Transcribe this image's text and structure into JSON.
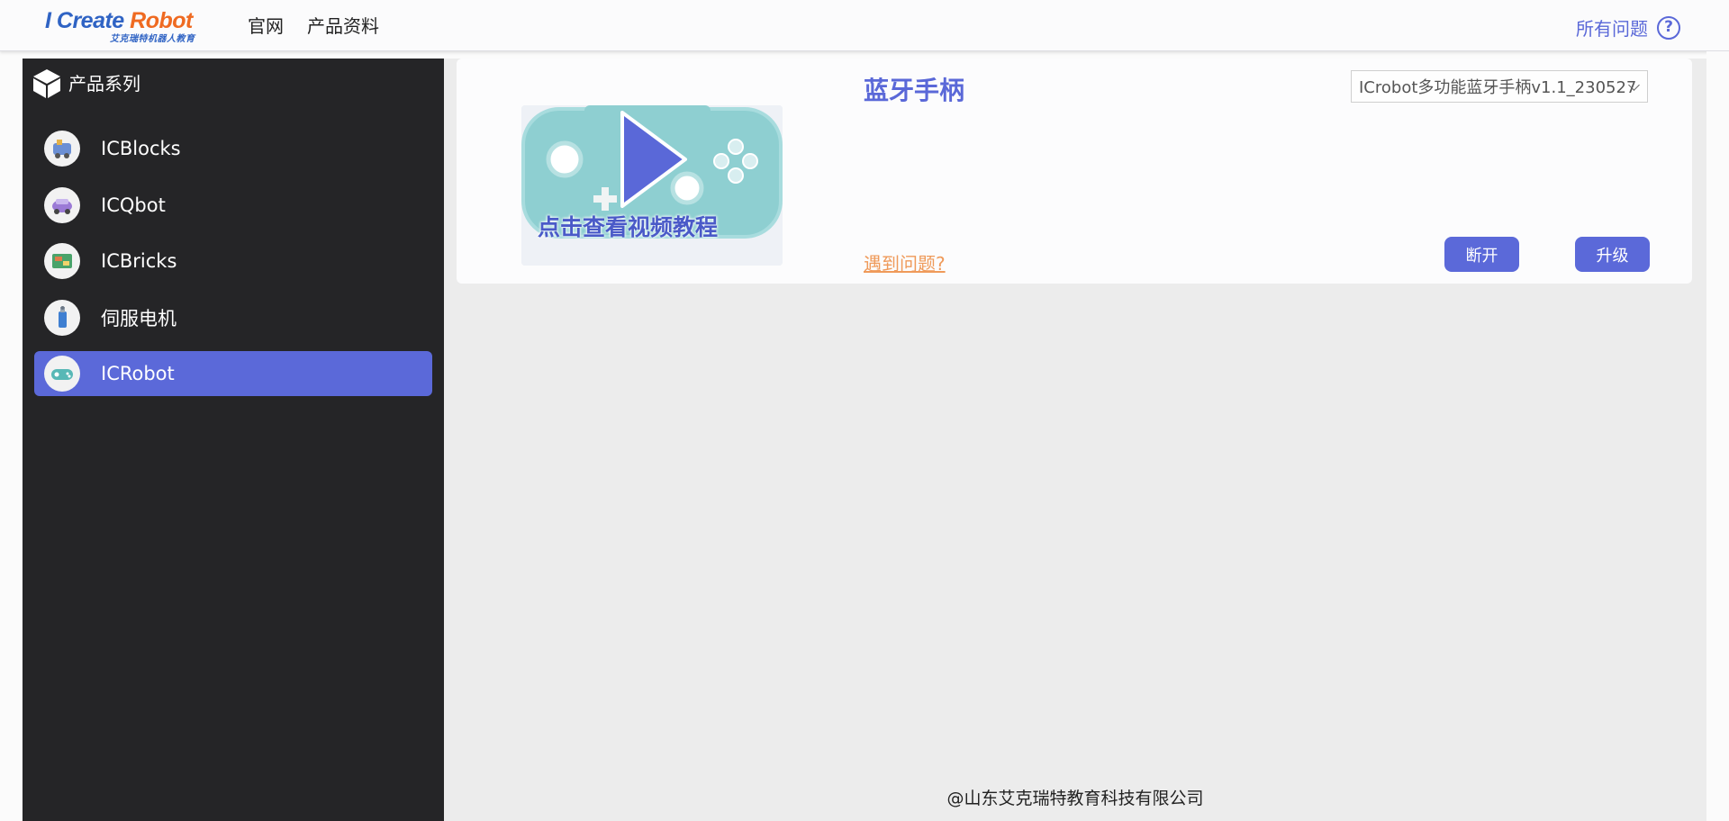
{
  "header": {
    "logo_main_blue": "I Create ",
    "logo_main_orange": "Robot",
    "logo_sub": "艾克瑞特机器人教育",
    "nav": [
      "官网",
      "产品资料"
    ],
    "faq_label": "所有问题",
    "faq_icon": "?"
  },
  "sidebar": {
    "title": "产品系列",
    "items": [
      {
        "label": "ICBlocks",
        "icon": "icblocks-icon",
        "active": false
      },
      {
        "label": "ICQbot",
        "icon": "icqbot-icon",
        "active": false
      },
      {
        "label": "ICBricks",
        "icon": "icbricks-icon",
        "active": false
      },
      {
        "label": "伺服电机",
        "icon": "servo-motor-icon",
        "active": false
      },
      {
        "label": "ICRobot",
        "icon": "icrobot-icon",
        "active": true
      }
    ]
  },
  "product": {
    "title": "蓝牙手柄",
    "video_caption": "点击查看视频教程",
    "problem_link": "遇到问题?",
    "firmware_selected": "ICrobot多功能蓝牙手柄v1.1_230527",
    "disconnect_label": "断开",
    "upgrade_label": "升级"
  },
  "footer": {
    "copyright": "@山东艾克瑞特教育科技有限公司"
  },
  "colors": {
    "accent": "#5b69d9",
    "sidebar_bg": "#252527",
    "link_orange": "#ef9a5a",
    "content_bg": "#ececec"
  }
}
